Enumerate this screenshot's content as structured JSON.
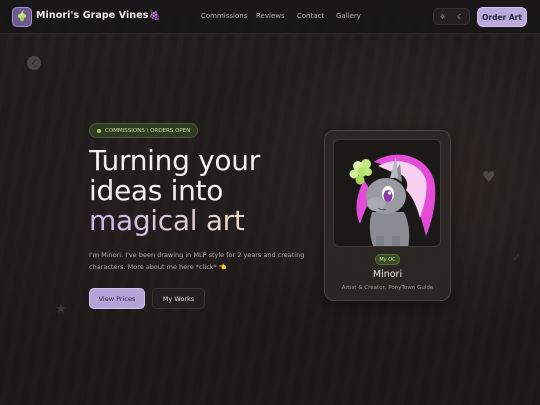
{
  "header": {
    "brand": "Minori's Grape Vines",
    "brand_emoji": "🍇",
    "logo_icon": "grape-logo",
    "nav": [
      "Commissions",
      "Reviews",
      "Contact",
      "Gallery"
    ],
    "toggle": {
      "left": "☼",
      "right": "☾"
    },
    "order_button": "Order Art"
  },
  "hero": {
    "badge": "COMMISSIONS \\ ORDERS OPEN",
    "title_line1": "Turning your",
    "title_line2": "ideas into",
    "title_highlight": "magical art",
    "lead": "I'm Minori. I've been drawing in MLP style for 2 years and creating characters. More about me here *click* 👈",
    "primary_button": "View Prices",
    "secondary_button": "My Works"
  },
  "card": {
    "tag": "My OC",
    "name": "Minori",
    "role": "Artist & Creator, PonyTown Guide"
  },
  "colors": {
    "accent": "#b9a9dc",
    "badge_green": "#9fd35c",
    "background": "#1b1919"
  }
}
